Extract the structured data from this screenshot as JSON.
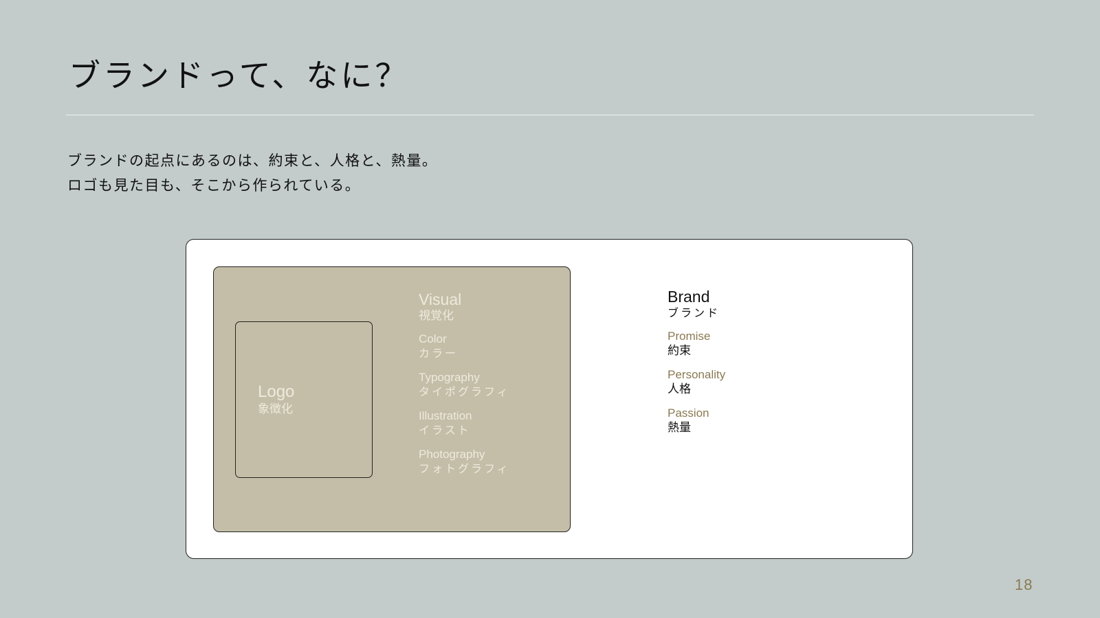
{
  "slide": {
    "title": "ブランドって、なに？",
    "lead": [
      "ブランドの起点にあるのは、約束と、人格と、熱量。",
      "ロゴも見た目も、そこから作られている。"
    ],
    "page_number": "18"
  },
  "diagram": {
    "logo": {
      "en": "Logo",
      "ja": "象徴化"
    },
    "visual": {
      "en": "Visual",
      "ja": "視覚化",
      "items": [
        {
          "en": "Color",
          "ja": "カラー"
        },
        {
          "en": "Typography",
          "ja": "タイポグラフィ"
        },
        {
          "en": "Illustration",
          "ja": "イラスト"
        },
        {
          "en": "Photography",
          "ja": "フォトグラフィ"
        }
      ]
    },
    "brand": {
      "en": "Brand",
      "ja": "ブランド",
      "items": [
        {
          "en": "Promise",
          "ja": "約束"
        },
        {
          "en": "Personality",
          "ja": "人格"
        },
        {
          "en": "Passion",
          "ja": "熱量"
        }
      ]
    }
  },
  "colors": {
    "background": "#c3ccca",
    "visual_box": "#c4bea8",
    "accent_gold": "#8a7a52",
    "light_text": "#eeeadd"
  }
}
